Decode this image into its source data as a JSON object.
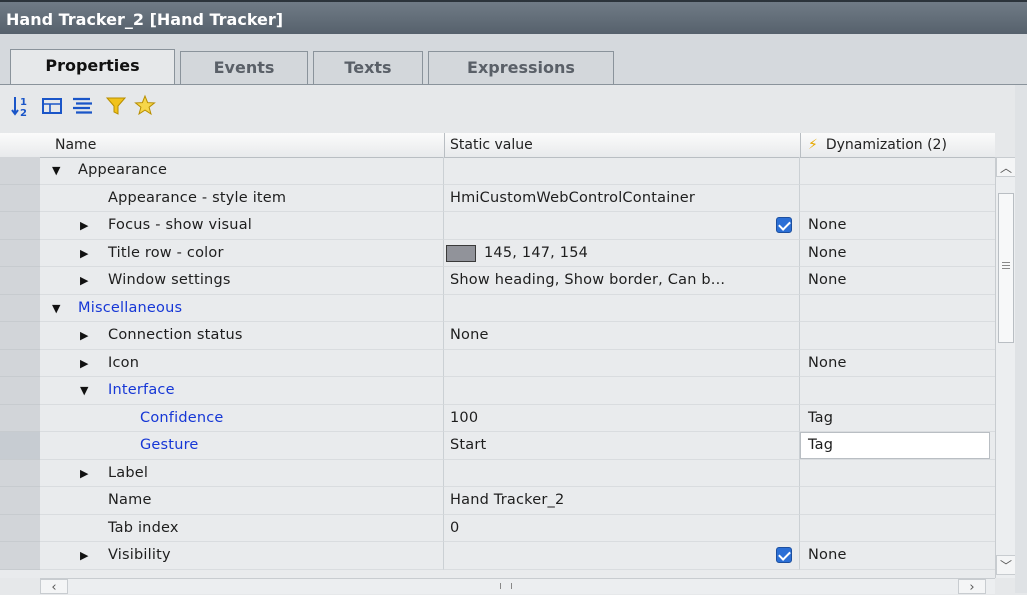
{
  "window": {
    "title": "Hand Tracker_2 [Hand Tracker]"
  },
  "tabs": [
    {
      "label": "Properties",
      "active": true
    },
    {
      "label": "Events"
    },
    {
      "label": "Texts"
    },
    {
      "label": "Expressions"
    }
  ],
  "toolbar": {
    "icons": [
      "sort-ascending-icon",
      "group-icon",
      "list-view-icon",
      "filter-icon",
      "favorites-star-icon"
    ]
  },
  "columns": {
    "name": "Name",
    "static_value": "Static value",
    "dynamization": "Dynamization (2)"
  },
  "rows": [
    {
      "name": "Appearance",
      "value": "",
      "dyn": "",
      "expander": "open"
    },
    {
      "name": "Appearance - style item",
      "value": "HmiCustomWebControlContainer",
      "dyn": ""
    },
    {
      "name": "Focus - show visual",
      "value": "",
      "dyn": "None",
      "expander": "closed",
      "checked": true
    },
    {
      "name": "Title row - color",
      "value": "145, 147, 154",
      "dyn": "None",
      "expander": "closed",
      "swatch": "#91939a"
    },
    {
      "name": "Window settings",
      "value": "Show heading, Show border, Can b...",
      "dyn": "None",
      "expander": "closed"
    },
    {
      "name": "Miscellaneous",
      "value": "",
      "dyn": "",
      "expander": "open",
      "link": true
    },
    {
      "name": "Connection status",
      "value": "None",
      "dyn": "",
      "expander": "closed"
    },
    {
      "name": "Icon",
      "value": "",
      "dyn": "None",
      "expander": "closed"
    },
    {
      "name": "Interface",
      "value": "",
      "dyn": "",
      "expander": "open",
      "link": true
    },
    {
      "name": "Confidence",
      "value": "100",
      "dyn": "Tag",
      "link": true
    },
    {
      "name": "Gesture",
      "value": "Start",
      "dyn": "Tag",
      "link": true,
      "editing": true
    },
    {
      "name": "Label",
      "value": "",
      "dyn": "",
      "expander": "closed"
    },
    {
      "name": "Name",
      "value": "Hand Tracker_2",
      "dyn": ""
    },
    {
      "name": "Tab index",
      "value": "0",
      "dyn": ""
    },
    {
      "name": "Visibility",
      "value": "",
      "dyn": "None",
      "expander": "closed",
      "checked": true
    }
  ],
  "colors": {
    "title_bar": "#5f6a75",
    "link_text": "#1637d6",
    "checkbox": "#2b6fd6",
    "title_row_swatch": "#91939a"
  }
}
